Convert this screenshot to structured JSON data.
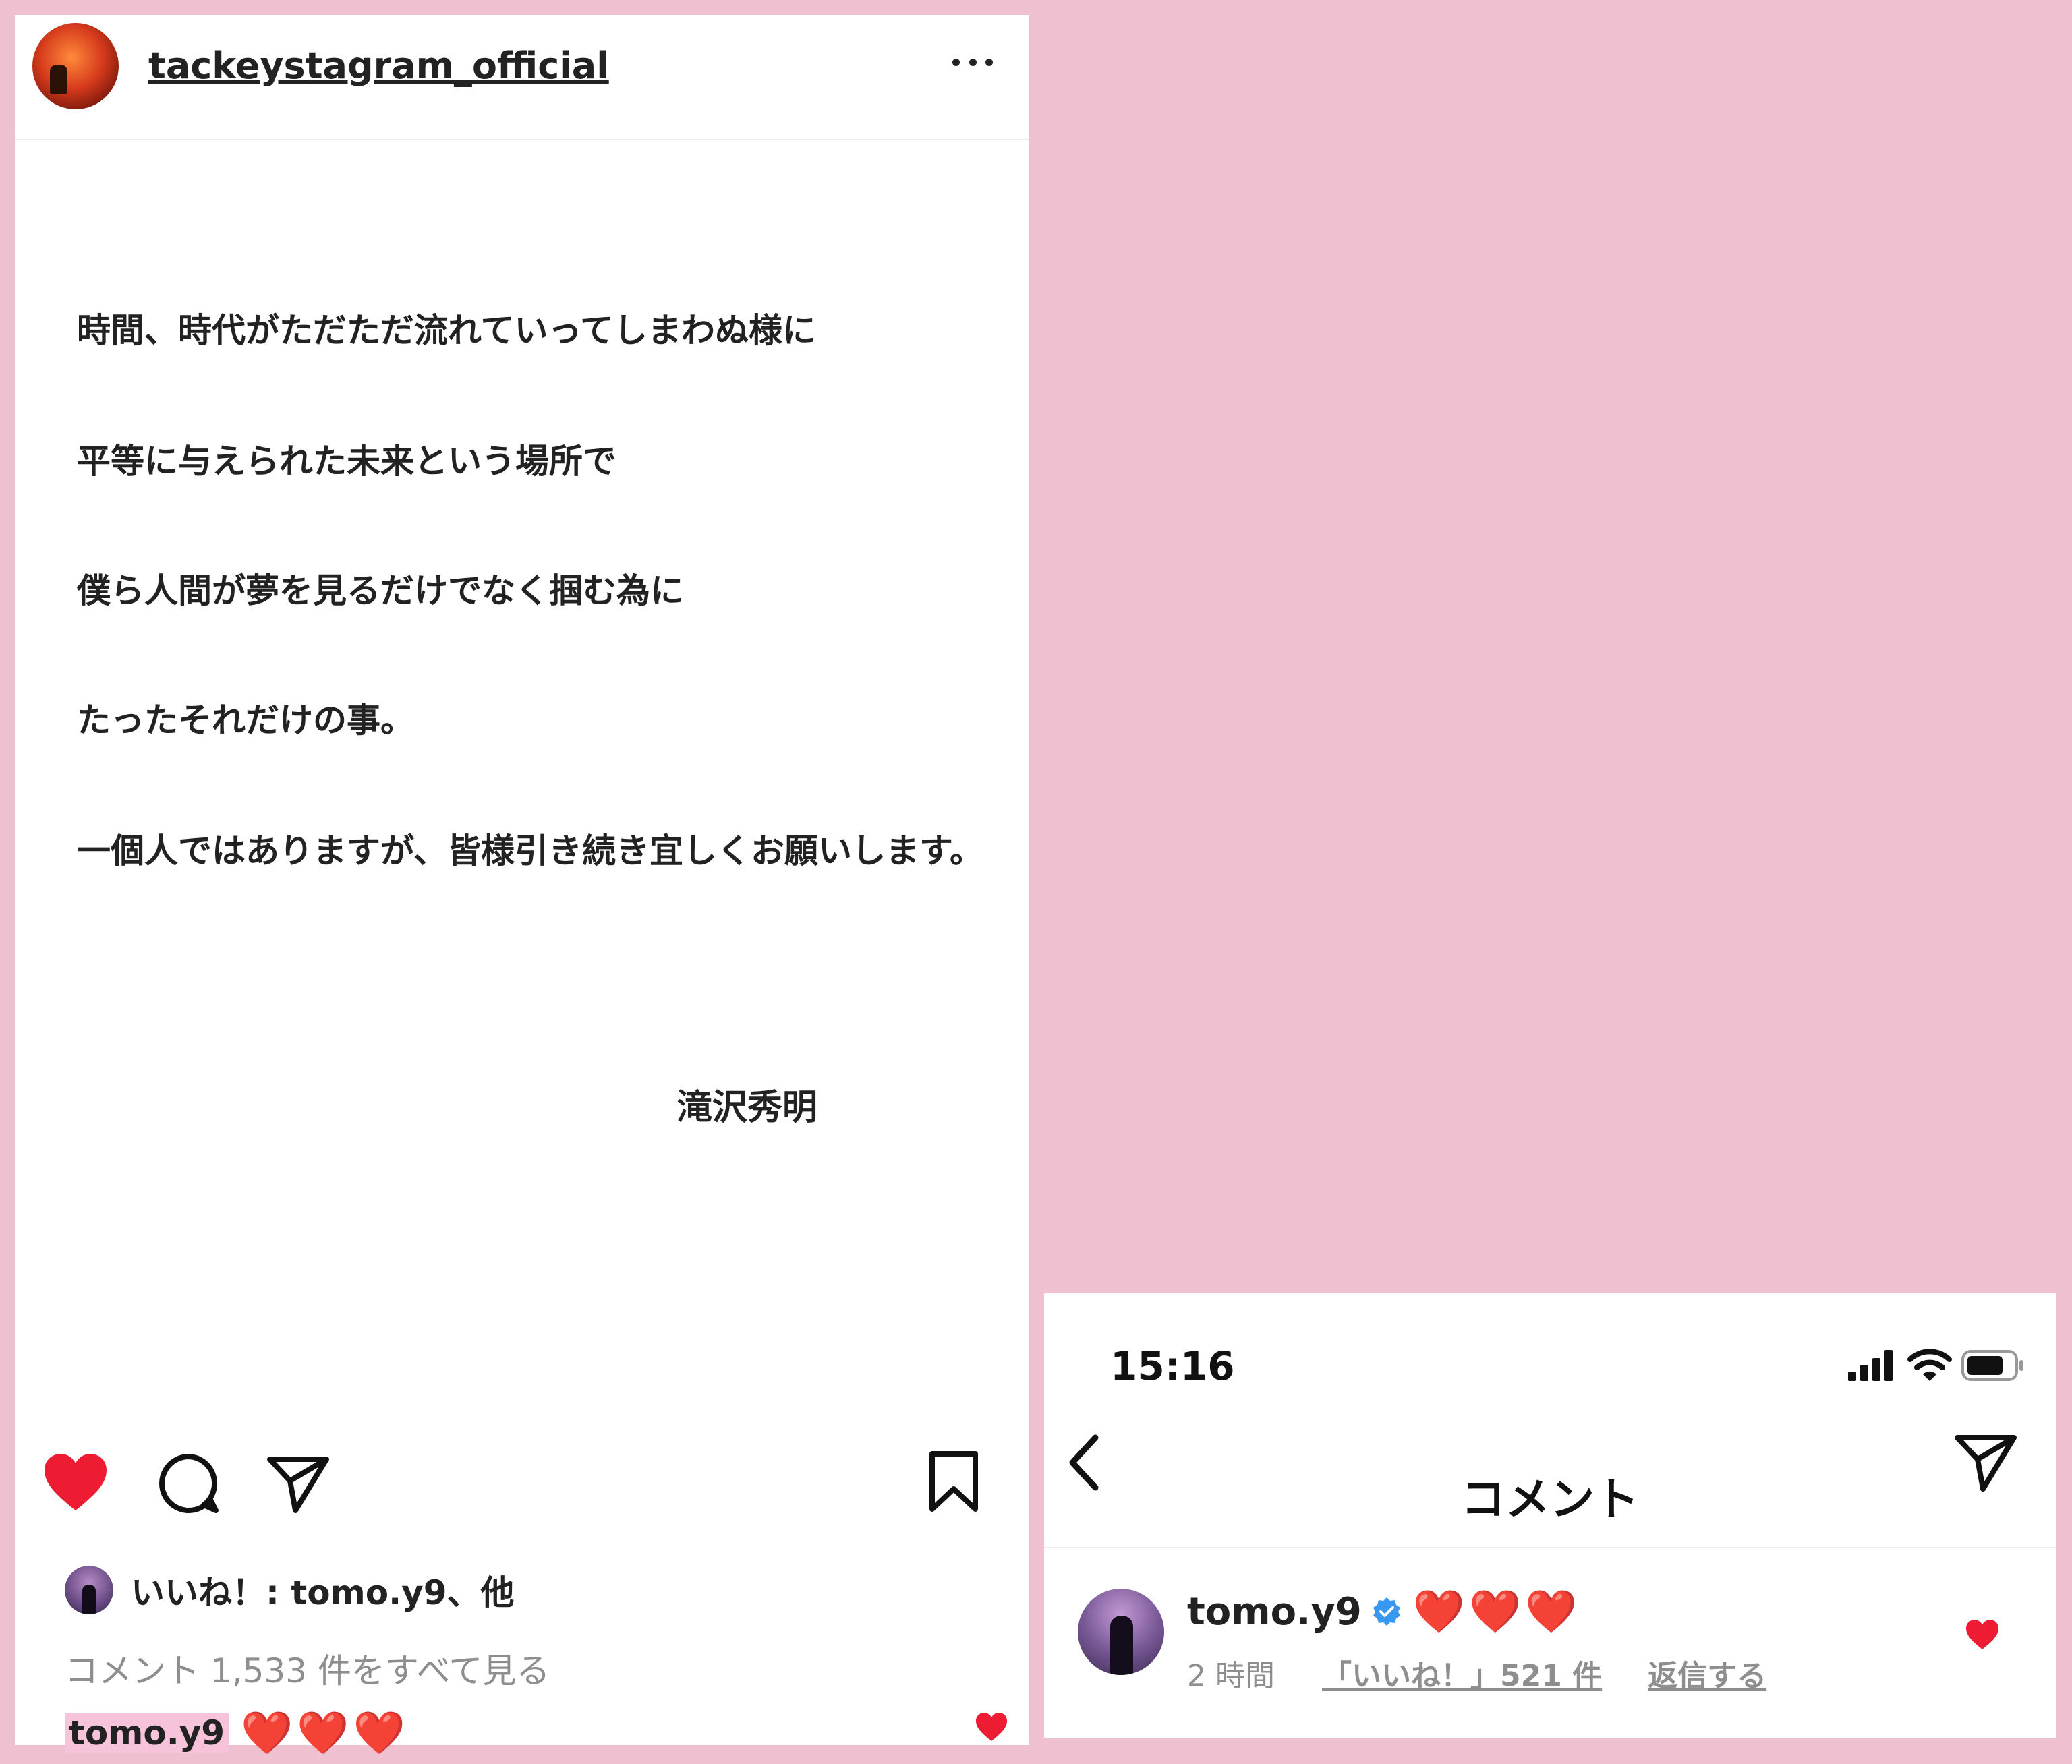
{
  "post": {
    "username": "tackeystagram_official",
    "caption_lines": [
      "時間、時代がただただ流れていってしまわぬ様に",
      "平等に与えられた未来という場所で",
      "僕ら人間が夢を見るだけでなく掴む為に",
      "たったそれだけの事。",
      "一個人ではありますが、皆様引き続き宜しくお願いします。"
    ],
    "signature": "滝沢秀明",
    "liked_by": "いいね！: tomo.y9、他",
    "view_all_comments": "コメント 1,533 件をすべて見る",
    "preview_comment": {
      "user": "tomo.y9",
      "text": "❤️❤️❤️"
    }
  },
  "comments_screen": {
    "status_time": "15:16",
    "title": "コメント",
    "comment": {
      "user": "tomo.y9",
      "text": "❤️❤️❤️",
      "time": "2 時間",
      "likes": "「いいね！」521 件",
      "reply": "返信する"
    }
  },
  "colors": {
    "background": "#EFC0D0",
    "heart_red": "#E0162B",
    "verified_blue": "#3897F0",
    "meta_gray": "#8e8e8e"
  },
  "icons": [
    "heart-filled-icon",
    "comment-icon",
    "share-icon",
    "bookmark-icon",
    "more-icon",
    "back-chevron-icon",
    "verified-badge-icon",
    "signal-icon",
    "wifi-icon",
    "battery-icon"
  ]
}
